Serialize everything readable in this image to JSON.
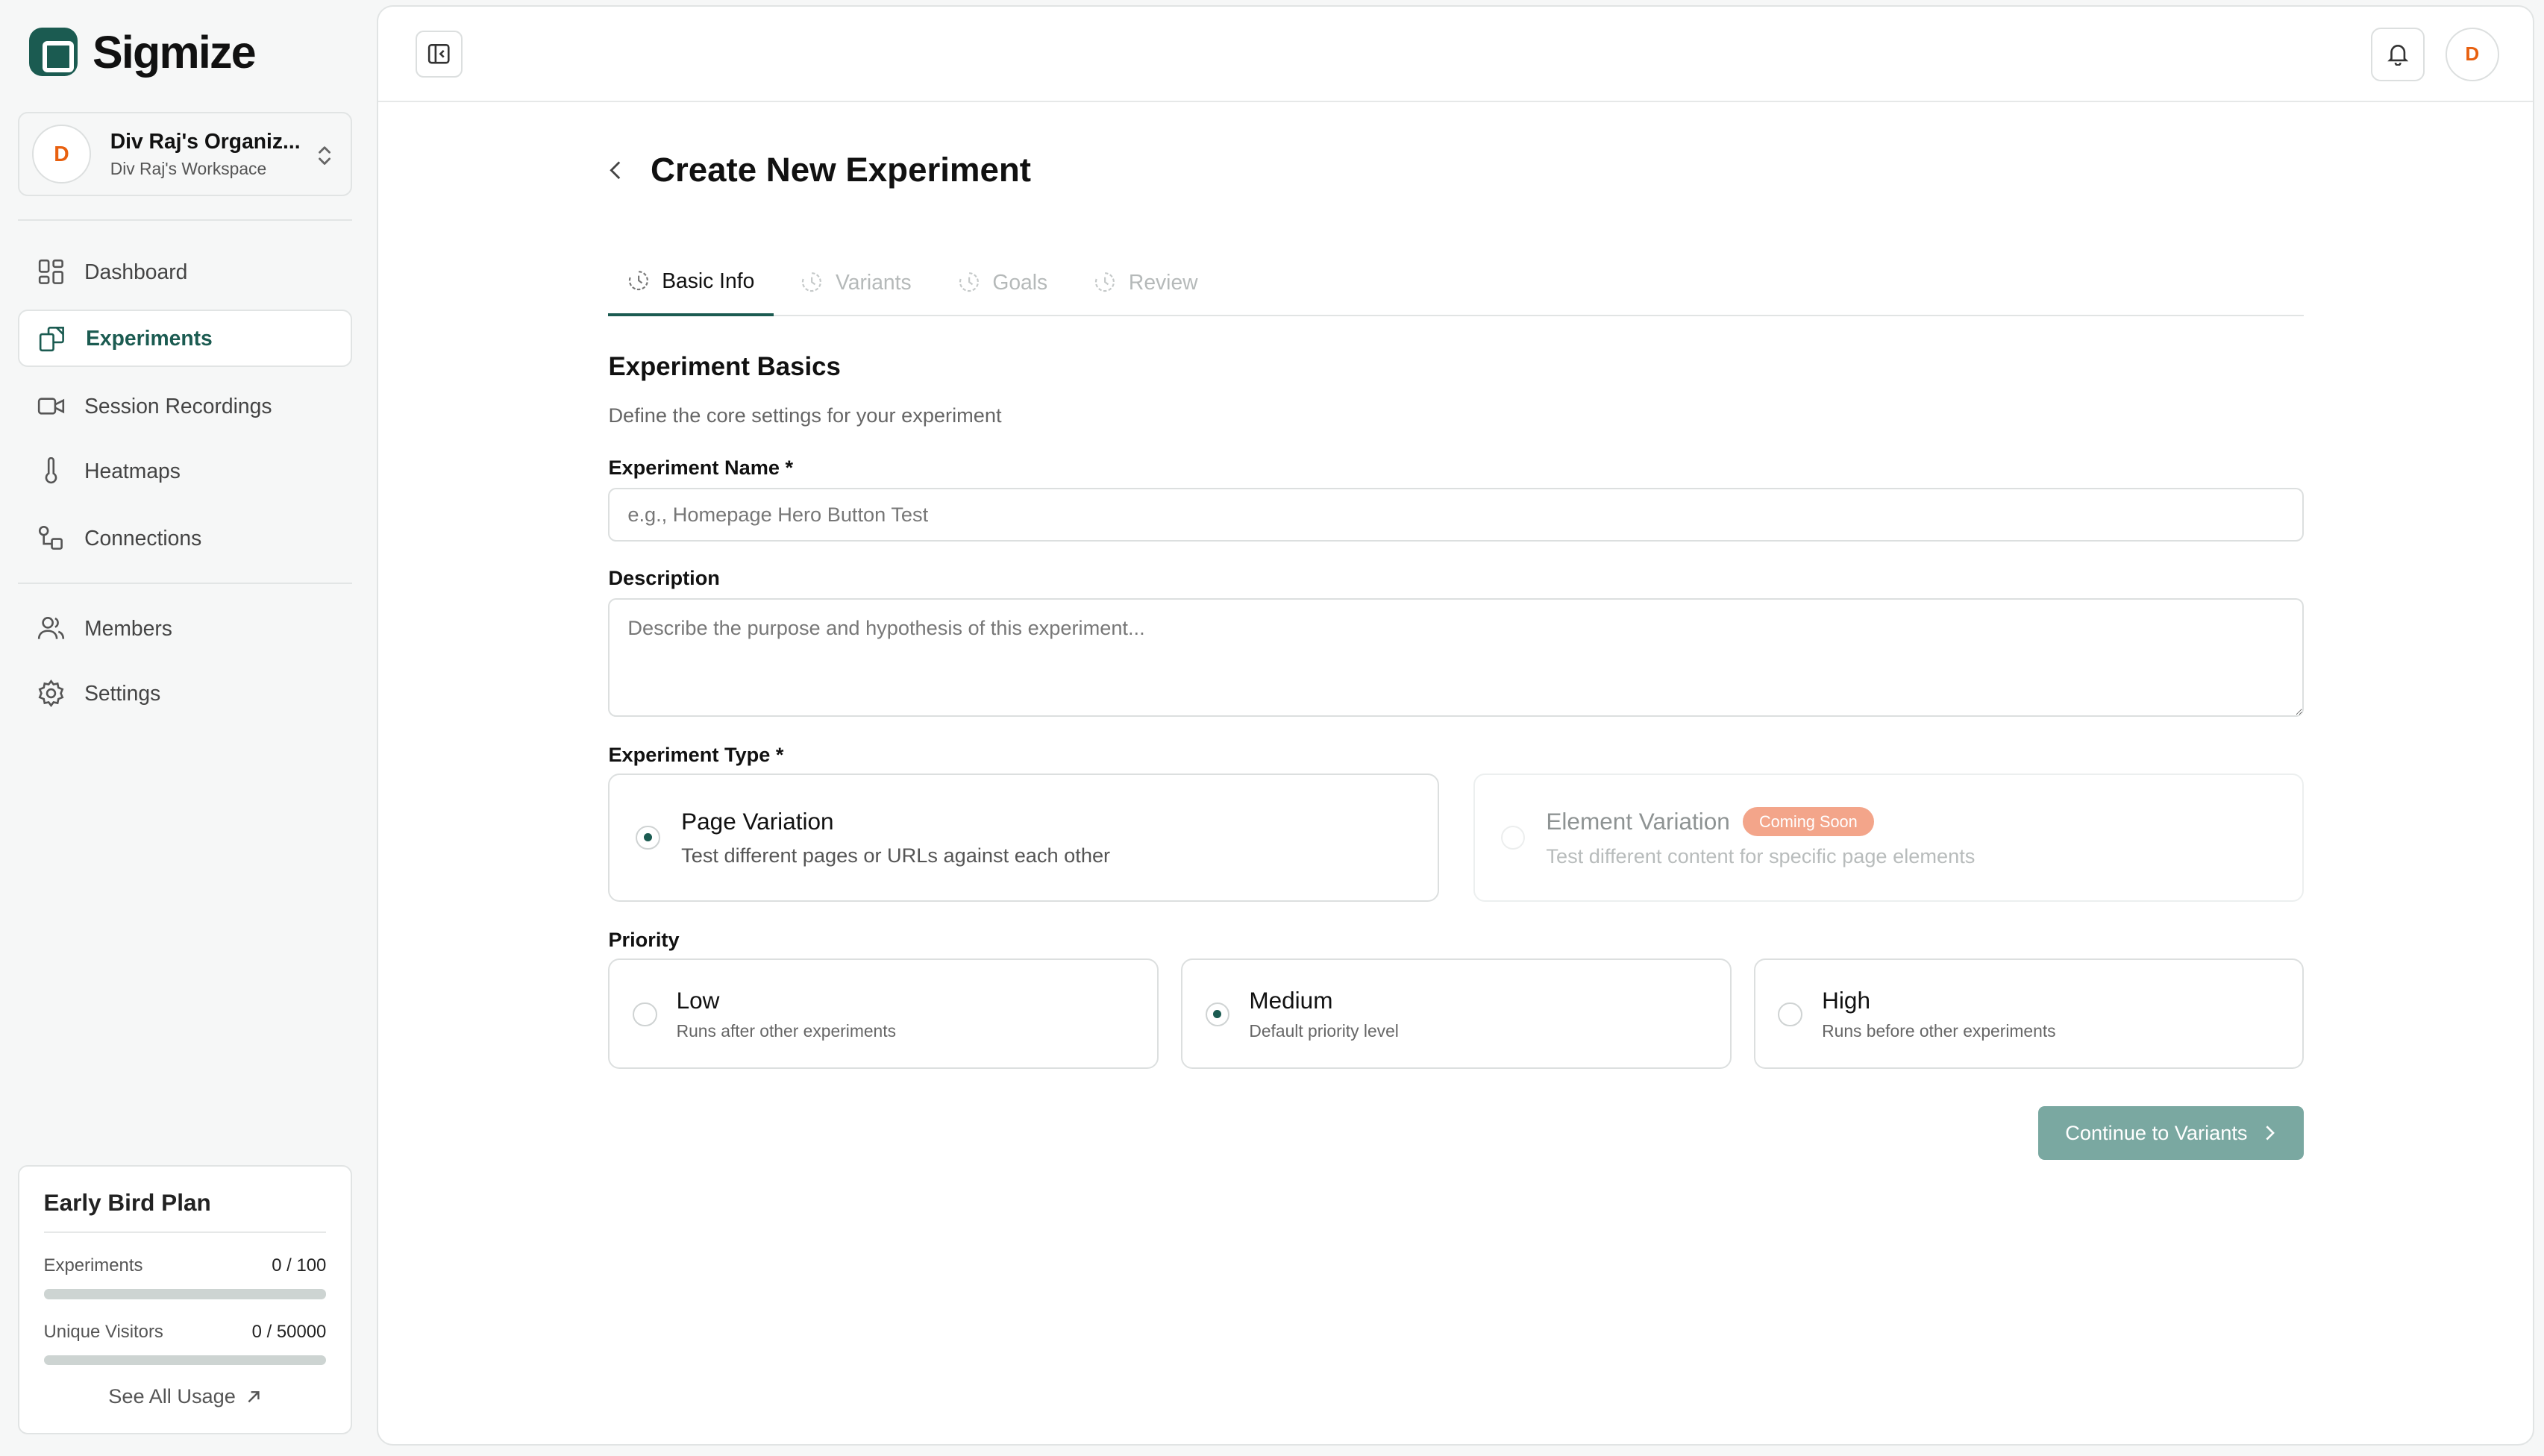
{
  "app": {
    "name": "Sigmize"
  },
  "org": {
    "avatar_letter": "D",
    "name": "Div Raj's Organiz...",
    "workspace": "Div Raj's Workspace"
  },
  "nav": {
    "items": [
      {
        "label": "Dashboard",
        "icon": "dashboard-grid-icon"
      },
      {
        "label": "Experiments",
        "icon": "experiments-icon",
        "active": true
      },
      {
        "label": "Session Recordings",
        "icon": "video-camera-icon"
      },
      {
        "label": "Heatmaps",
        "icon": "thermometer-icon"
      },
      {
        "label": "Connections",
        "icon": "connections-icon"
      },
      {
        "label": "Members",
        "icon": "users-icon"
      },
      {
        "label": "Settings",
        "icon": "gear-icon"
      }
    ]
  },
  "plan": {
    "title": "Early Bird Plan",
    "experiments_label": "Experiments",
    "experiments_value": "0 / 100",
    "experiments_fraction": 0,
    "visitors_label": "Unique Visitors",
    "visitors_value": "0 / 50000",
    "visitors_fraction": 0,
    "link": "See All Usage"
  },
  "topbar": {
    "user_avatar_letter": "D"
  },
  "page": {
    "title": "Create New Experiment",
    "tabs": [
      {
        "label": "Basic Info",
        "active": true
      },
      {
        "label": "Variants"
      },
      {
        "label": "Goals"
      },
      {
        "label": "Review"
      }
    ],
    "section_title": "Experiment Basics",
    "section_subtitle": "Define the core settings for your experiment",
    "name_label": "Experiment Name *",
    "name_placeholder": "e.g., Homepage Hero Button Test",
    "name_value": "",
    "description_label": "Description",
    "description_placeholder": "Describe the purpose and hypothesis of this experiment...",
    "type_label": "Experiment Type *",
    "types": [
      {
        "title": "Page Variation",
        "subtitle": "Test different pages or URLs against each other",
        "selected": true
      },
      {
        "title": "Element Variation",
        "subtitle": "Test different content for specific page elements",
        "badge": "Coming Soon",
        "disabled": true
      }
    ],
    "priority_label": "Priority",
    "priorities": [
      {
        "title": "Low",
        "subtitle": "Runs after other experiments"
      },
      {
        "title": "Medium",
        "subtitle": "Default priority level",
        "selected": true
      },
      {
        "title": "High",
        "subtitle": "Runs before other experiments"
      }
    ],
    "continue_label": "Continue to Variants"
  },
  "colors": {
    "brand": "#1b5b51",
    "button_disabled": "#7aa8a1",
    "badge": "#f3a58a",
    "avatar_letter": "#e8600f"
  }
}
